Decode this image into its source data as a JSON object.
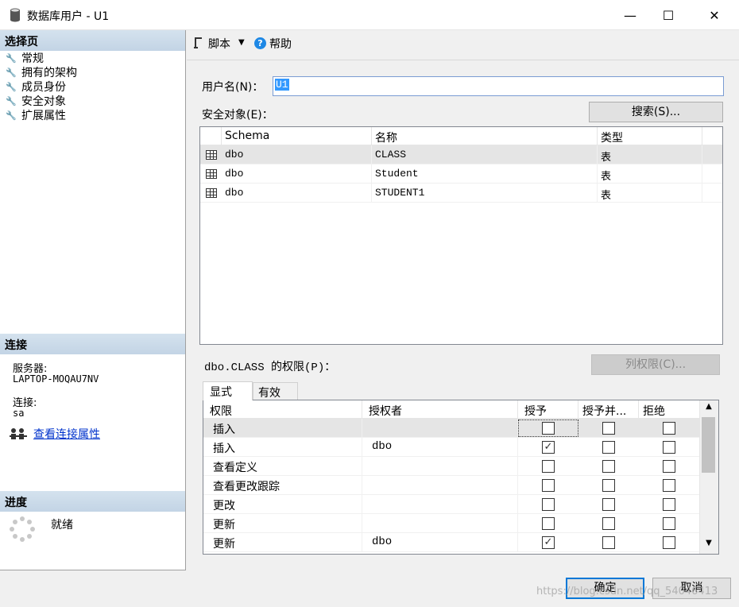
{
  "window": {
    "title": "数据库用户 - U1",
    "controls": {
      "minimize": "—",
      "maximize": "☐",
      "close": "✕"
    }
  },
  "left_panel": {
    "select_page_header": "选择页",
    "pages": [
      {
        "label": "常规",
        "icon": "wrench-icon"
      },
      {
        "label": "拥有的架构",
        "icon": "wrench-icon"
      },
      {
        "label": "成员身份",
        "icon": "wrench-icon"
      },
      {
        "label": "安全对象",
        "icon": "wrench-icon"
      },
      {
        "label": "扩展属性",
        "icon": "wrench-icon"
      }
    ],
    "connection_header": "连接",
    "server_label": "服务器:",
    "server_value": "LAPTOP-MOQAU7NV",
    "connection_label": "连接:",
    "connection_value": "sa",
    "view_connection_link": "查看连接属性",
    "progress_header": "进度",
    "progress_status": "就绪"
  },
  "toolbar": {
    "script_label": "脚本",
    "dropdown_glyph": "▼",
    "help_label": "帮助",
    "help_glyph": "?"
  },
  "form": {
    "username_label": "用户名(N)：",
    "username_value": "U1",
    "securables_label": "安全对象(E)：",
    "search_button": "搜索(S)...",
    "permissions_label": "dbo.CLASS 的权限(P)：",
    "column_permissions_button": "列权限(C)..."
  },
  "securables_table": {
    "columns": [
      "Schema",
      "名称",
      "类型"
    ],
    "rows": [
      {
        "schema": "dbo",
        "name": "CLASS",
        "type": "表",
        "selected": true
      },
      {
        "schema": "dbo",
        "name": "Student",
        "type": "表",
        "selected": false
      },
      {
        "schema": "dbo",
        "name": "STUDENT1",
        "type": "表",
        "selected": false
      }
    ]
  },
  "permission_tabs": [
    "显式",
    "有效"
  ],
  "permissions_table": {
    "columns": [
      "权限",
      "授权者",
      "授予",
      "授予并...",
      "拒绝"
    ],
    "rows": [
      {
        "permission": "插入",
        "grantor": "",
        "grant": false,
        "with_grant": false,
        "deny": false,
        "selected": true
      },
      {
        "permission": "插入",
        "grantor": "dbo",
        "grant": true,
        "with_grant": false,
        "deny": false,
        "selected": false
      },
      {
        "permission": "查看定义",
        "grantor": "",
        "grant": false,
        "with_grant": false,
        "deny": false,
        "selected": false
      },
      {
        "permission": "查看更改跟踪",
        "grantor": "",
        "grant": false,
        "with_grant": false,
        "deny": false,
        "selected": false
      },
      {
        "permission": "更改",
        "grantor": "",
        "grant": false,
        "with_grant": false,
        "deny": false,
        "selected": false
      },
      {
        "permission": "更新",
        "grantor": "",
        "grant": false,
        "with_grant": false,
        "deny": false,
        "selected": false
      },
      {
        "permission": "更新",
        "grantor": "dbo",
        "grant": true,
        "with_grant": false,
        "deny": false,
        "selected": false
      }
    ],
    "scroll_up_glyph": "▲",
    "scroll_down_glyph": "▼"
  },
  "buttons": {
    "ok": "确定",
    "cancel": "取消"
  },
  "watermark": "https://blog.csdn.net/qq_54046413",
  "colors": {
    "section_header": "#c8d8e8",
    "link": "#0033cc",
    "selection": "#3399ff",
    "help_icon": "#1e88e5"
  }
}
